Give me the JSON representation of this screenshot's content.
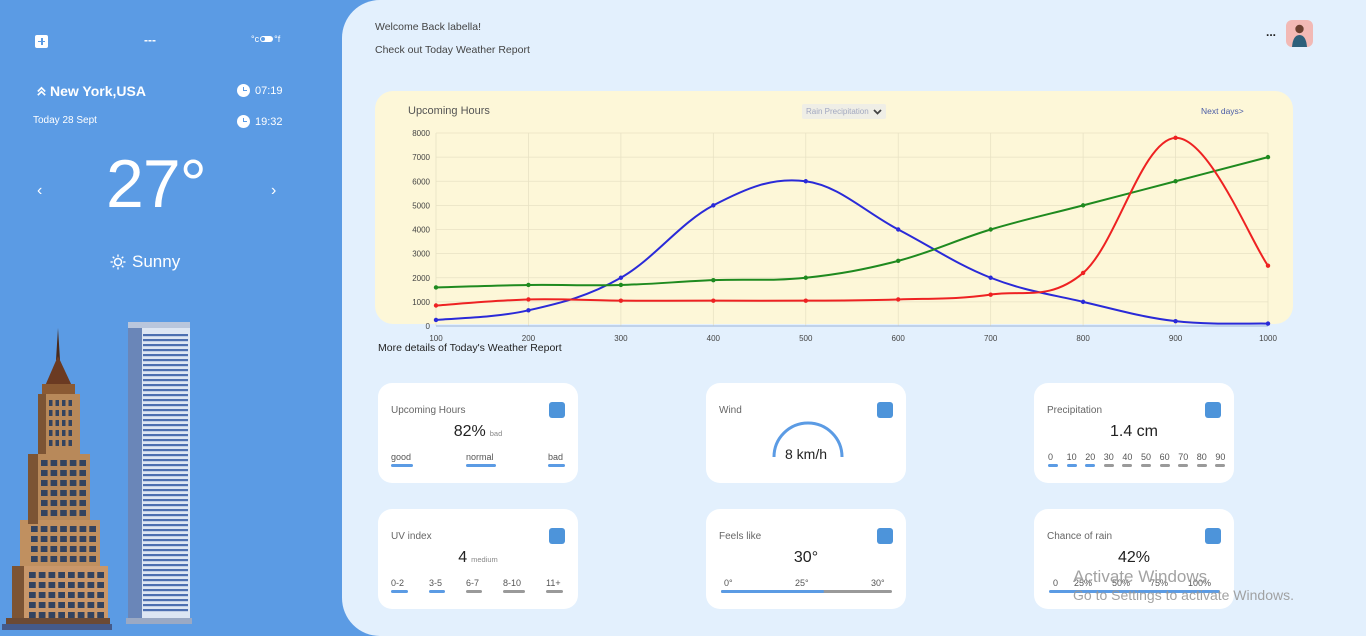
{
  "left": {
    "plus_icon": "plus-icon",
    "menu_dots": "---",
    "units": {
      "celsius": "°c",
      "fahrenheit": "°f"
    },
    "location": "New York,USA",
    "date": "Today 28 Sept",
    "sunrise": "07:19",
    "sunset": "19:32",
    "temperature": "27°",
    "condition": "Sunny",
    "prev_arrow": "‹",
    "next_arrow": "›"
  },
  "header": {
    "welcome": "Welcome Back labella!",
    "subtitle": "Check out Today Weather Report",
    "dots": "..."
  },
  "chart_card": {
    "title": "Upcoming Hours",
    "select": "Rain Precipitation",
    "next_days": "Next days>"
  },
  "chart_data": {
    "type": "line",
    "x": [
      100,
      200,
      300,
      400,
      500,
      600,
      700,
      800,
      900,
      1000
    ],
    "ylim": [
      0,
      8000
    ],
    "yticks": [
      "0",
      "1000",
      "2000",
      "3000",
      "4000",
      "5000",
      "6000",
      "7000",
      "8000"
    ],
    "xticks": [
      "100",
      "200",
      "300",
      "400",
      "500",
      "600",
      "700",
      "800",
      "900",
      "1000"
    ],
    "grid": true,
    "series": [
      {
        "color": "#2a2ad8",
        "values": [
          250,
          650,
          2000,
          5000,
          6000,
          4000,
          2000,
          1000,
          200,
          100
        ]
      },
      {
        "color": "#1f8a1f",
        "values": [
          1600,
          1700,
          1700,
          1900,
          2000,
          2700,
          4000,
          5000,
          6000,
          7000
        ]
      },
      {
        "color": "#ee2222",
        "values": [
          850,
          1100,
          1050,
          1050,
          1050,
          1100,
          1300,
          2200,
          7800,
          2500
        ]
      }
    ]
  },
  "more_details": "More details of Today's Weather Report",
  "cards": {
    "upcoming": {
      "label": "Upcoming Hours",
      "value": "82%",
      "sub": "bad",
      "scale": [
        "good",
        "normal",
        "bad"
      ]
    },
    "wind": {
      "label": "Wind",
      "value": "8 km/h"
    },
    "precip": {
      "label": "Precipitation",
      "value": "1.4 cm",
      "scale": [
        "0",
        "10",
        "20",
        "30",
        "40",
        "50",
        "60",
        "70",
        "80",
        "90"
      ]
    },
    "uv": {
      "label": "UV index",
      "value": "4",
      "sub": "medium",
      "scale": [
        "0-2",
        "3-5",
        "6-7",
        "8-10",
        "11+"
      ]
    },
    "feels": {
      "label": "Feels like",
      "value": "30°",
      "scale": [
        "0°",
        "25°",
        "30°"
      ],
      "fill": 0.6
    },
    "rain": {
      "label": "Chance of rain",
      "value": "42%",
      "scale": [
        "0",
        "25%",
        "50%",
        "75%",
        "100%"
      ]
    }
  },
  "watermark": {
    "title": "Activate Windows",
    "sub": "Go to Settings to activate Windows."
  }
}
